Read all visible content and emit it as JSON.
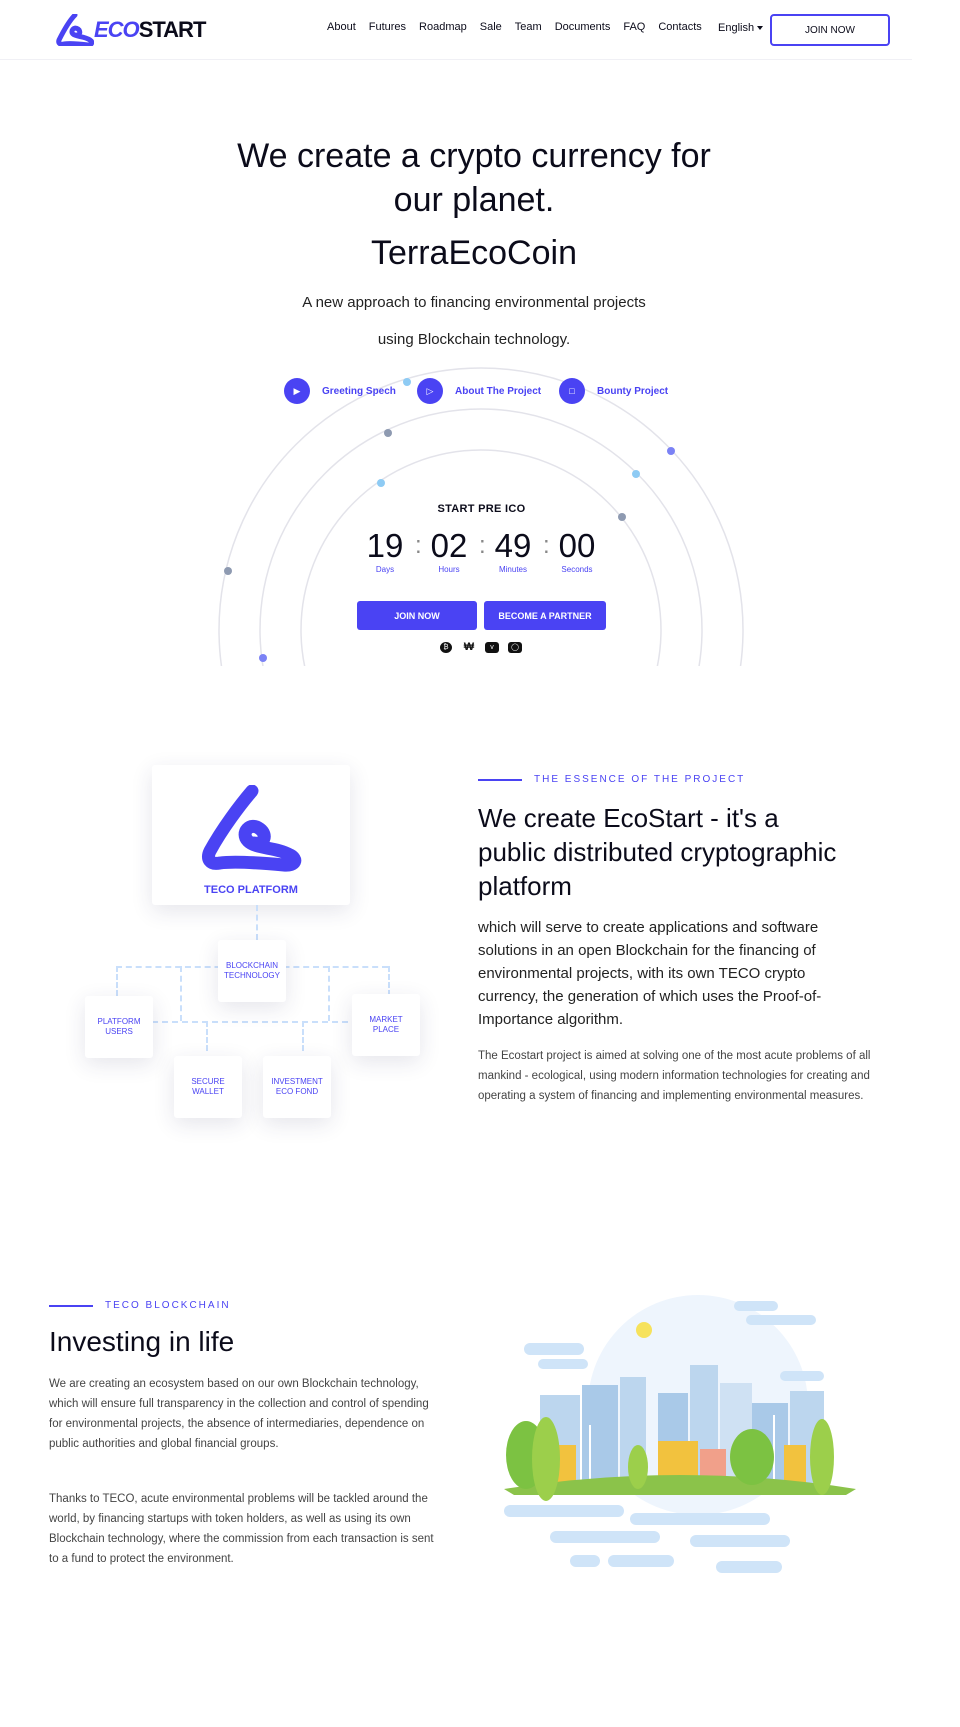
{
  "brand": {
    "eco": "ECO",
    "start": "START"
  },
  "nav": {
    "links": [
      "About",
      "Futures",
      "Roadmap",
      "Sale",
      "Team",
      "Documents",
      "FAQ",
      "Contacts"
    ],
    "language": "English",
    "join_label": "JOIN NOW"
  },
  "hero": {
    "title_line1": "We create a crypto currency for",
    "title_line2": "our planet.",
    "subtitle": "TerraEcoCoin",
    "desc_line1": "A new approach to financing environmental projects",
    "desc_line2": "using Blockchain technology.",
    "pills": [
      {
        "label": "Greeting Spech",
        "icon": "youtube-icon"
      },
      {
        "label": "About The Project",
        "icon": "play-icon"
      },
      {
        "label": "Bounty Project",
        "icon": "document-icon"
      }
    ],
    "start_label": "START PRE ICO",
    "countdown": [
      {
        "value": "19",
        "unit": "Days"
      },
      {
        "value": "02",
        "unit": "Hours"
      },
      {
        "value": "49",
        "unit": "Minutes"
      },
      {
        "value": "00",
        "unit": "Seconds"
      }
    ],
    "join_label": "JOIN NOW",
    "partner_label": "BECOME A PARTNER",
    "payment_icons": [
      "bitcoin-icon",
      "won-icon",
      "visa-icon",
      "mastercard-icon"
    ]
  },
  "essence": {
    "eyebrow": "THE ESSENCE OF THE PROJECT",
    "title": "We create EcoStart - it's a public distributed cryptographic platform",
    "lead": "which will serve to create applications and software solutions in an open Blockchain for the financing of environmental projects, with its own TECO crypto currency, the generation of which uses the Proof-of-Importance algorithm.",
    "body": "The Ecostart project is aimed at solving one of the most acute problems of all mankind - ecological, using modern information technologies for creating and operating a system of financing and implementing environmental measures.",
    "diagram": {
      "platform": "TECO PLATFORM",
      "blockchain": [
        "BLOCKCHAIN",
        "TECHNOLOGY"
      ],
      "users": [
        "PLATFORM",
        "USERS"
      ],
      "market": [
        "MARKET",
        "PLACE"
      ],
      "wallet": [
        "SECURE",
        "WALLET"
      ],
      "fond": [
        "INVESTMENT",
        "ECO FOND"
      ]
    }
  },
  "blockchain": {
    "eyebrow": "TECO BLOCKCHAIN",
    "title": "Investing in life",
    "p1": "We are creating an ecosystem based on our own Blockchain technology, which will ensure full transparency in the collection and control of spending for environmental projects, the absence of intermediaries, dependence on public authorities and global financial groups.",
    "p2": "Thanks to TECO, acute environmental problems will be tackled around the world, by financing startups with token holders, as well as using its own Blockchain technology, where the commission from each transaction is sent to a fund to protect the environment."
  },
  "colors": {
    "accent": "#4a43f3",
    "light_blue": "#8ecbf4",
    "grey_dot": "#8e9ab1"
  }
}
